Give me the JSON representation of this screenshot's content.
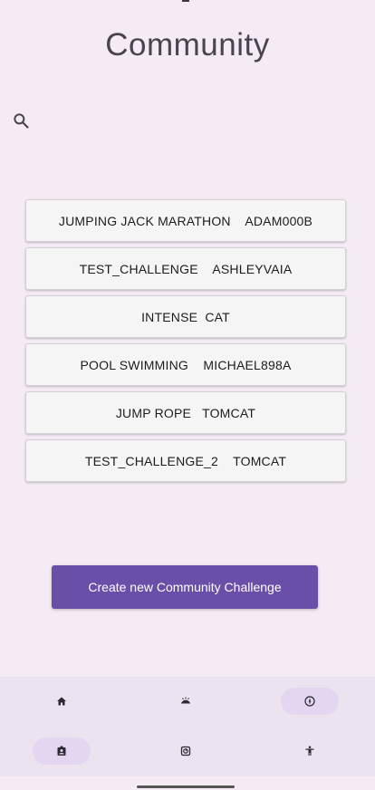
{
  "page": {
    "title": "Community"
  },
  "search": {
    "icon": "search-icon"
  },
  "challenges": [
    {
      "label": "JUMPING JACK MARATHON    ADAM000B"
    },
    {
      "label": "TEST_CHALLENGE    ASHLEYVAIA"
    },
    {
      "label": "INTENSE  CAT"
    },
    {
      "label": "POOL SWIMMING    MICHAEL898A"
    },
    {
      "label": "JUMP ROPE   TOMCAT"
    },
    {
      "label": "TEST_CHALLENGE_2    TOMCAT"
    }
  ],
  "create_button": {
    "label": "Create new Community Challenge"
  },
  "bottom_nav": {
    "items": [
      {
        "icon": "home-icon",
        "active": false
      },
      {
        "icon": "workout-icon",
        "active": false
      },
      {
        "icon": "compass-icon",
        "active": true
      },
      {
        "icon": "contact-badge-icon",
        "active": true
      },
      {
        "icon": "scale-icon",
        "active": false
      },
      {
        "icon": "accessibility-icon",
        "active": false
      }
    ]
  },
  "colors": {
    "background": "#f4ebf4",
    "accent": "#6a4fa8",
    "nav_bg": "#ece3f0",
    "nav_active": "#e2d6f0"
  }
}
